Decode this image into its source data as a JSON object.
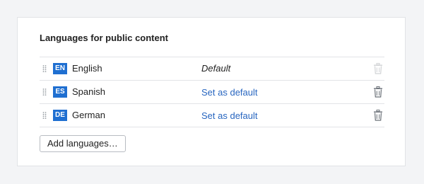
{
  "section": {
    "title": "Languages for public content"
  },
  "languages": [
    {
      "code": "EN",
      "name": "English",
      "status": "Default",
      "is_default": true
    },
    {
      "code": "ES",
      "name": "Spanish",
      "status": "Set as default",
      "is_default": false
    },
    {
      "code": "DE",
      "name": "German",
      "status": "Set as default",
      "is_default": false
    }
  ],
  "actions": {
    "add_label": "Add languages…"
  },
  "colors": {
    "badge": "#1f6fd1",
    "link": "#2866c0",
    "background": "#f3f4f6"
  },
  "icons": {
    "drag": "drag-handle-icon",
    "delete": "trash-icon"
  }
}
